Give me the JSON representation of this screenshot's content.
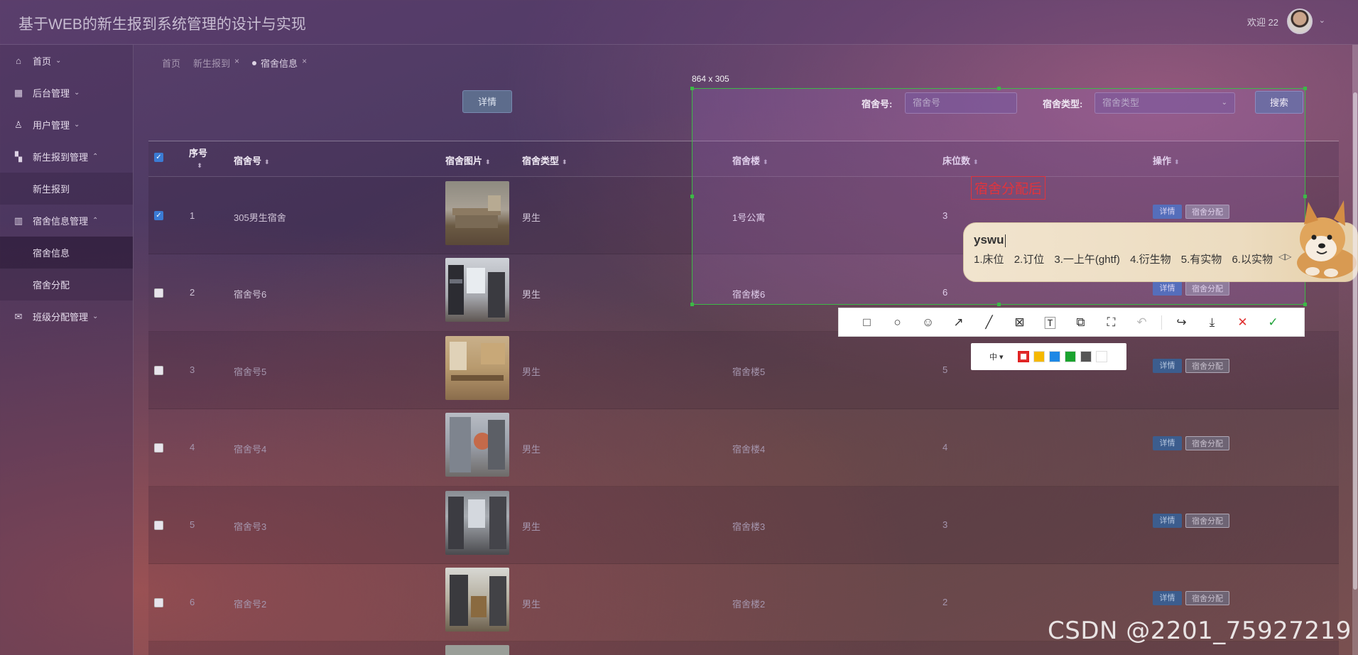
{
  "app": {
    "title": "基于WEB的新生报到系统管理的设计与实现",
    "welcome": "欢迎 22"
  },
  "sidebar": {
    "items": [
      {
        "label": "首页",
        "icon": "home-icon",
        "expanded": false
      },
      {
        "label": "后台管理",
        "icon": "grid-icon",
        "expanded": false
      },
      {
        "label": "用户管理",
        "icon": "user-badge-icon",
        "expanded": false
      },
      {
        "label": "新生报到管理",
        "icon": "dashboard-icon",
        "expanded": true,
        "children": [
          {
            "label": "新生报到"
          }
        ]
      },
      {
        "label": "宿舍信息管理",
        "icon": "columns-icon",
        "expanded": true,
        "children": [
          {
            "label": "宿舍信息",
            "active": true
          },
          {
            "label": "宿舍分配"
          }
        ]
      },
      {
        "label": "班级分配管理",
        "icon": "mail-icon",
        "expanded": false
      }
    ]
  },
  "tabs": [
    {
      "label": "首页",
      "closable": false
    },
    {
      "label": "新生报到",
      "closable": true
    },
    {
      "label": "宿舍信息",
      "closable": true,
      "active": true
    }
  ],
  "toolbar": {
    "detail_label": "详情"
  },
  "search": {
    "room_label": "宿舍号:",
    "room_placeholder": "宿舍号",
    "type_label": "宿舍类型:",
    "type_placeholder": "宿舍类型",
    "search_label": "搜索"
  },
  "table": {
    "headers": {
      "index": "序号",
      "room": "宿舍号",
      "image": "宿舍图片",
      "type": "宿舍类型",
      "building": "宿舍楼",
      "beds": "床位数",
      "actions": "操作"
    },
    "rows": [
      {
        "index": "1",
        "room": "305男生宿舍",
        "type": "男生",
        "building": "1号公寓",
        "beds": "3",
        "checked": true
      },
      {
        "index": "2",
        "room": "宿舍号6",
        "type": "男生",
        "building": "宿舍楼6",
        "beds": "6",
        "checked": false
      },
      {
        "index": "3",
        "room": "宿舍号5",
        "type": "男生",
        "building": "宿舍楼5",
        "beds": "5",
        "checked": false
      },
      {
        "index": "4",
        "room": "宿舍号4",
        "type": "男生",
        "building": "宿舍楼4",
        "beds": "4",
        "checked": false
      },
      {
        "index": "5",
        "room": "宿舍号3",
        "type": "男生",
        "building": "宿舍楼3",
        "beds": "3",
        "checked": false
      },
      {
        "index": "6",
        "room": "宿舍号2",
        "type": "男生",
        "building": "宿舍楼2",
        "beds": "2",
        "checked": false
      }
    ],
    "detail_label": "详情",
    "assign_label": "宿舍分配"
  },
  "capture": {
    "size_label": "864 x 305",
    "annotation_text": "宿舍分配后",
    "size_picker": "中",
    "colors": [
      "#e02020",
      "#f5b800",
      "#1e88e5",
      "#1aa32f",
      "#555555",
      "#ffffff"
    ]
  },
  "ime": {
    "composition": "yswu",
    "candidates": [
      "1.床位",
      "2.订位",
      "3.一上午(ghtf)",
      "4.衍生物",
      "5.有实物",
      "6.以实物"
    ],
    "next": "◁▷"
  },
  "watermark": "CSDN @2201_75927219"
}
